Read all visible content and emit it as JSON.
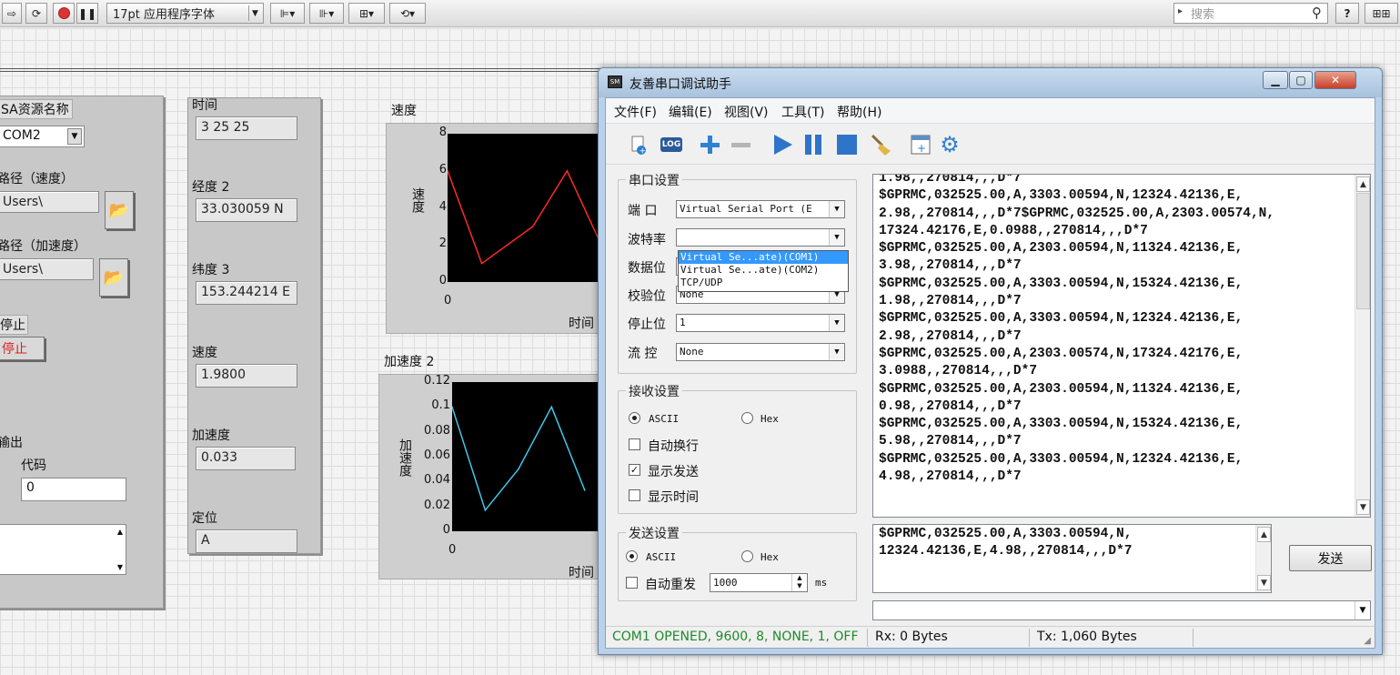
{
  "lv_toolbar": {
    "font_select": "17pt 应用程序字体",
    "search_placeholder": "搜索"
  },
  "lv_panel": {
    "visa_label": "SA资源名称",
    "visa_value": "COM2",
    "path_speed_label": "路径（速度）",
    "path_speed_value": "Users\\",
    "path_accel_label": "路径（加速度）",
    "path_accel_value": "Users\\",
    "stop_label": "停止",
    "stop_button": "停止",
    "output_label": "输出",
    "code_label": "代码",
    "code_value": "0",
    "time_label": "时间",
    "time_value": "3 25 25",
    "lon_label": "经度 2",
    "lon_value": "33.030059 N",
    "lat_label": "纬度 3",
    "lat_value": "153.244214 E",
    "speed_label": "速度",
    "speed_value": "1.9800",
    "accel_label": "加速度",
    "accel_value": "0.033",
    "fix_label": "定位",
    "fix_value": "A"
  },
  "chart_data": [
    {
      "type": "line",
      "title": "速度",
      "xlabel": "时间",
      "ylabel": "速度",
      "yticks": [
        "8",
        "6",
        "4",
        "2",
        "0"
      ],
      "xticks": [
        "0"
      ],
      "ylim": [
        0,
        8
      ],
      "xlim": [
        0,
        9
      ],
      "color": "#ff2a2a",
      "x": [
        0,
        2,
        5,
        7,
        9
      ],
      "y": [
        6,
        1,
        3,
        6,
        2
      ]
    },
    {
      "type": "line",
      "title": "加速度 2",
      "xlabel": "时间",
      "ylabel": "加速度",
      "yticks": [
        "0.12",
        "0.1",
        "0.08",
        "0.06",
        "0.04",
        "0.02",
        "0"
      ],
      "xticks": [
        "0"
      ],
      "ylim": [
        0,
        0.12
      ],
      "xlim": [
        0,
        9
      ],
      "color": "#3fc8e8",
      "x": [
        0,
        2,
        4,
        6,
        8
      ],
      "y": [
        0.1,
        0.017,
        0.05,
        0.1,
        0.033
      ]
    }
  ],
  "serial": {
    "title": "友善串口调试助手",
    "menu": [
      "文件(F)",
      "编辑(E)",
      "视图(V)",
      "工具(T)",
      "帮助(H)"
    ],
    "port_group": "串口设置",
    "port_label": "端  口",
    "port_value": "Virtual Serial Port (E",
    "baud_label": "波特率",
    "data_label": "数据位",
    "data_value": "8",
    "parity_label": "校验位",
    "parity_value": "None",
    "stop_label": "停止位",
    "stop_value": "1",
    "flow_label": "流  控",
    "flow_value": "None",
    "dropdown_options": [
      "Virtual Se...ate)(COM1)",
      "Virtual Se...ate)(COM2)",
      "TCP/UDP"
    ],
    "recv_group": "接收设置",
    "recv_ascii": "ASCII",
    "recv_hex": "Hex",
    "auto_wrap": "自动换行",
    "show_send": "显示发送",
    "show_time": "显示时间",
    "send_group": "发送设置",
    "send_ascii": "ASCII",
    "send_hex": "Hex",
    "auto_resend": "自动重发",
    "interval_value": "1000",
    "interval_unit": "ms",
    "send_button": "发送",
    "rx_lines": [
      "1.98,,270814,,,D*7",
      "$GPRMC,032525.00,A,3303.00594,N,12324.42136,E,",
      "2.98,,270814,,,D*7$GPRMC,032525.00,A,2303.00574,N,",
      "17324.42176,E,0.0988,,270814,,,D*7",
      "$GPRMC,032525.00,A,2303.00594,N,11324.42136,E,",
      "3.98,,270814,,,D*7",
      "$GPRMC,032525.00,A,3303.00594,N,15324.42136,E,",
      "1.98,,270814,,,D*7",
      "$GPRMC,032525.00,A,3303.00594,N,12324.42136,E,",
      "2.98,,270814,,,D*7",
      "$GPRMC,032525.00,A,2303.00574,N,17324.42176,E,",
      "3.0988,,270814,,,D*7",
      "$GPRMC,032525.00,A,2303.00594,N,11324.42136,E,",
      "0.98,,270814,,,D*7",
      "$GPRMC,032525.00,A,3303.00594,N,15324.42136,E,",
      "5.98,,270814,,,D*7",
      "$GPRMC,032525.00,A,3303.00594,N,12324.42136,E,",
      "4.98,,270814,,,D*7"
    ],
    "tx_lines": [
      "$GPRMC,032525.00,A,3303.00594,N,",
      "12324.42136,E,4.98,,270814,,,D*7"
    ],
    "status": {
      "port": "COM1 OPENED, 9600, 8, NONE, 1, OFF",
      "rx": "Rx: 0 Bytes",
      "tx": "Tx: 1,060 Bytes"
    }
  }
}
